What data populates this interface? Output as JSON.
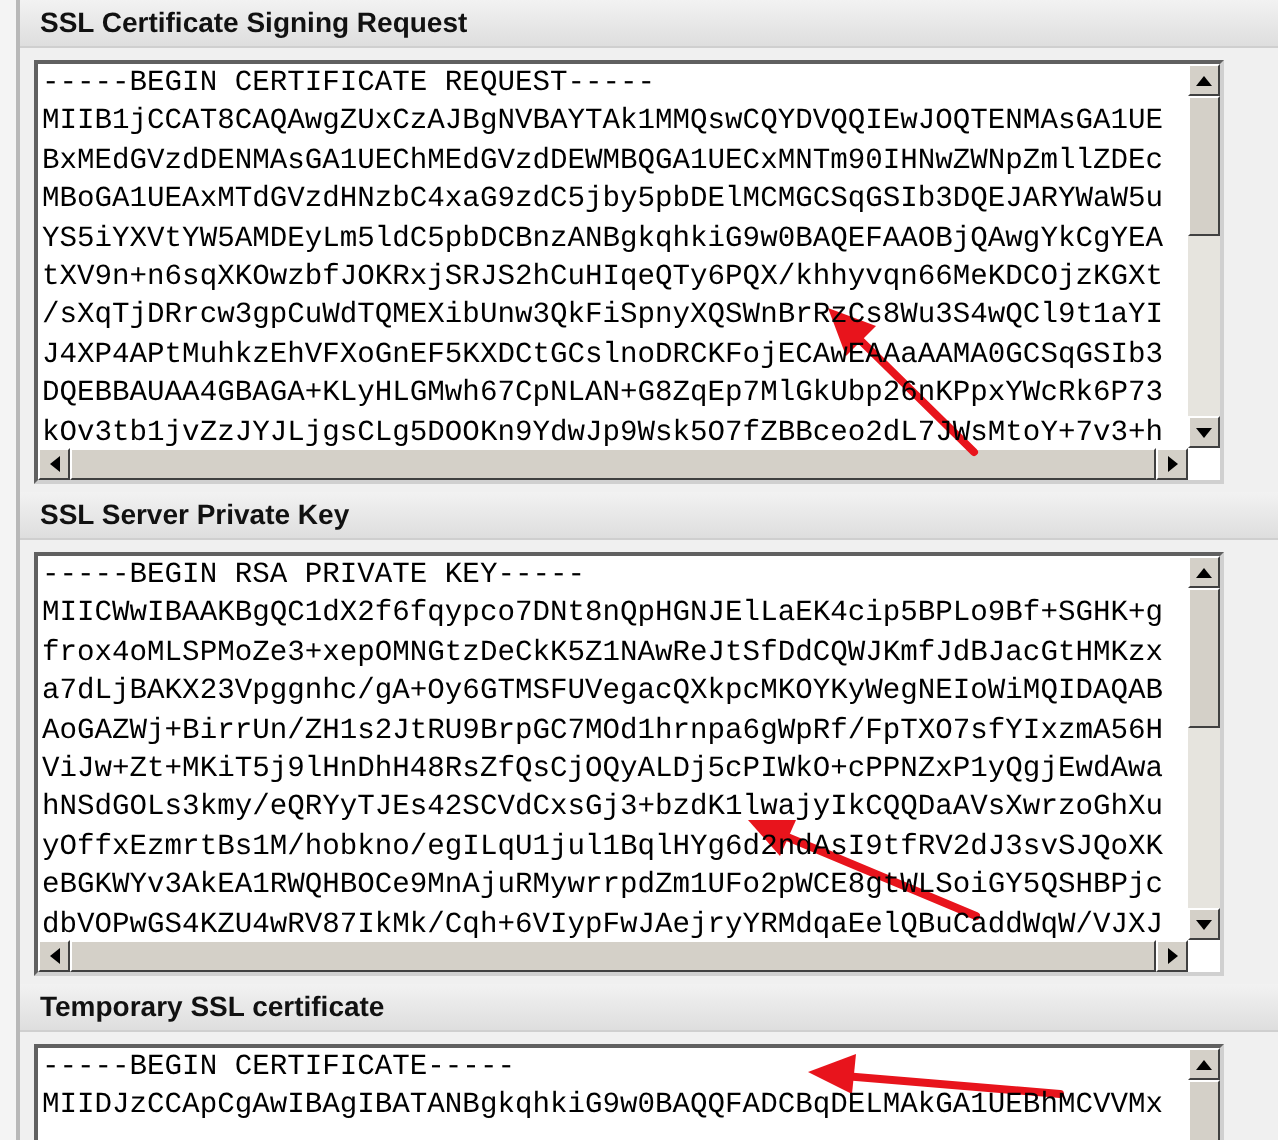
{
  "sections": [
    {
      "title": "SSL Certificate Signing Request",
      "lines": [
        "-----BEGIN CERTIFICATE REQUEST-----",
        "MIIB1jCCAT8CAQAwgZUxCzAJBgNVBAYTAk1MMQswCQYDVQQIEwJOQTENMAsGA1UE",
        "BxMEdGVzdDENMAsGA1UEChMEdGVzdDEWMBQGA1UECxMNTm90IHNwZWNpZmllZDEc",
        "MBoGA1UEAxMTdGVzdHNzbC4xaG9zdC5jby5pbDElMCMGCSqGSIb3DQEJARYWaW5u",
        "YS5iYXVtYW5AMDEyLm5ldC5pbDCBnzANBgkqhkiG9w0BAQEFAAOBjQAwgYkCgYEA",
        "tXV9n+n6sqXKOwzbfJOKRxjSRJS2hCuHIqeQTy6PQX/khhyvqn66MeKDCOjzKGXt",
        "/sXqTjDRrcw3gpCuWdTQMEXibUnw3QkFiSpnyXQSWnBrRzCs8Wu3S4wQCl9t1aYI",
        "J4XP4APtMuhkzEhVFXoGnEF5KXDCtGCslnoDRCKFojECAwEAAaAAMA0GCSqGSIb3",
        "DQEBBAUAA4GBAGA+KLyHLGMwh67CpNLAN+G8ZqEp7MlGkUbp26nKPpxYWcRk6P73",
        "kOv3tb1jvZzJYJLjgsCLg5DOOKn9YdwJp9Wsk5O7fZBBceo2dL7JWsMtoY+7v3+h"
      ]
    },
    {
      "title": "SSL Server Private Key",
      "lines": [
        "-----BEGIN RSA PRIVATE KEY-----",
        "MIICWwIBAAKBgQC1dX2f6fqypco7DNt8nQpHGNJElLaEK4cip5BPLo9Bf+SGHK+g",
        "frox4oMLSPMoZe3+xepOMNGtzDeCkK5Z1NAwReJtSfDdCQWJKmfJdBJacGtHMKzx",
        "a7dLjBAKX23Vpggnhc/gA+Oy6GTMSFUVegacQXkpcMKOYKyWegNEIoWiMQIDAQAB",
        "AoGAZWj+BirrUn/ZH1s2JtRU9BrpGC7MOd1hrnpa6gWpRf/FpTXO7sfYIxzmA56H",
        "ViJw+Zt+MKiT5j9lHnDhH48RsZfQsCjOQyALDj5cPIWkO+cPPNZxP1yQgjEwdAwa",
        "hNSdGOLs3kmy/eQRYyTJEs42SCVdCxsGj3+bzdK1lwajyIkCQQDaAVsXwrzoGhXu",
        "yOffxEzmrtBs1M/hobkno/egILqU1jul1BqlHYg6d2ndAsI9tfRV2dJ3svSJQoXK",
        "eBGKWYv3AkEA1RWQHBOCe9MnAjuRMywrrpdZm1UFo2pWCE8gtWLSoiGY5QSHBPjc",
        "dbVOPwGS4KZU4wRV87IkMk/Cqh+6VIypFwJAejryYRMdqaEelQBuCaddWqW/VJXJ"
      ]
    },
    {
      "title": "Temporary SSL certificate",
      "lines": [
        "-----BEGIN CERTIFICATE-----",
        "MIIDJzCCApCgAwIBAgIBATANBgkqhkiG9w0BAQQFADCBqDELMAkGA1UEBhMCVVMx"
      ]
    }
  ]
}
